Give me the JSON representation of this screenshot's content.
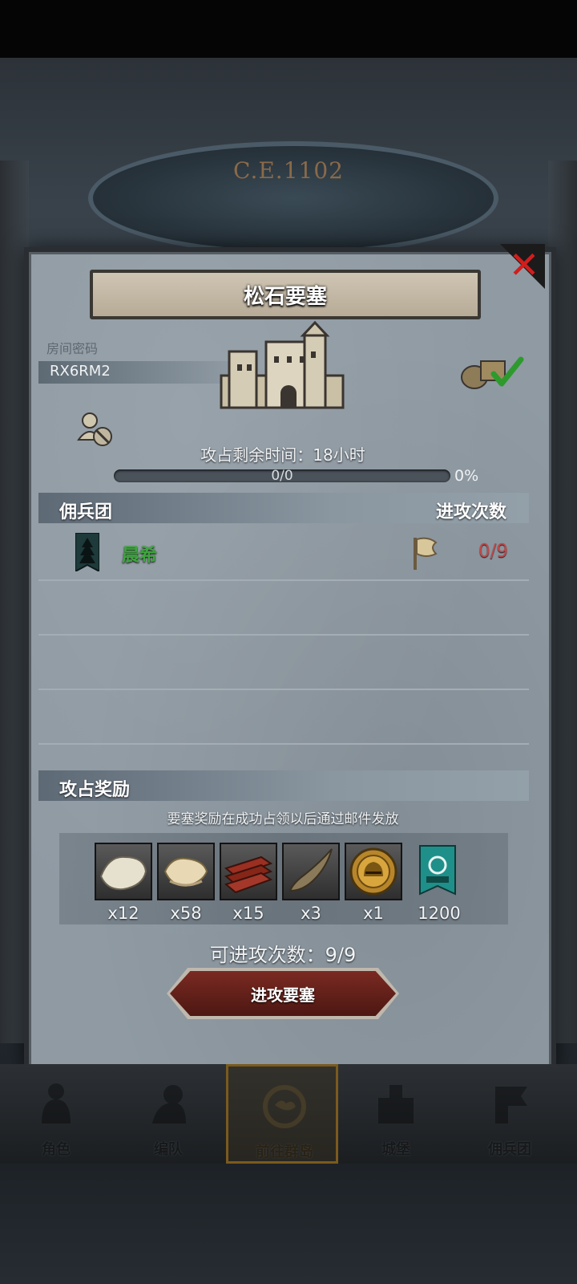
{
  "background": {
    "era_text": "C.E.1102"
  },
  "dialog": {
    "title": "松石要塞",
    "close_icon": "close-x-icon",
    "room_password_label": "房间密码",
    "room_password_value": "RX6RM2",
    "occupy_time_label": "攻占剩余时间：18小时",
    "progress": {
      "count_text": "0/0",
      "percent_text": "0%",
      "fraction": 0
    },
    "mercenary_header": "佣兵团",
    "attack_count_header": "进攻次数",
    "mercenaries": [
      {
        "name": "晨希",
        "attacks": "0/9"
      }
    ],
    "reward_header": "攻占奖励",
    "reward_note": "要塞奖励在成功占领以后通过邮件发放",
    "rewards": [
      {
        "icon": "fur-icon",
        "count": "x12"
      },
      {
        "icon": "hide-icon",
        "count": "x58"
      },
      {
        "icon": "wood-planks-icon",
        "count": "x15"
      },
      {
        "icon": "horn-icon",
        "count": "x3"
      },
      {
        "icon": "knight-helmet-coin-icon",
        "count": "x1"
      },
      {
        "icon": "castle-banner-icon",
        "count": "1200"
      }
    ],
    "attacks_left_text": "可进攻次数：9/9",
    "attack_button_label": "进攻要塞"
  },
  "bottom_nav": [
    {
      "label": "角色",
      "icon": "character-icon",
      "active": false
    },
    {
      "label": "编队",
      "icon": "formation-icon",
      "active": false
    },
    {
      "label": "前往群岛",
      "icon": "islands-icon",
      "active": true
    },
    {
      "label": "城堡",
      "icon": "castle-icon",
      "active": false
    },
    {
      "label": "佣兵团",
      "icon": "mercenary-icon",
      "active": false
    }
  ],
  "colors": {
    "panel": "#8f9aa3",
    "mercenary_name": "#3fa63f",
    "attack_count": "#c0494a",
    "button": "#7a2a22",
    "close_x": "#d21d1d"
  }
}
